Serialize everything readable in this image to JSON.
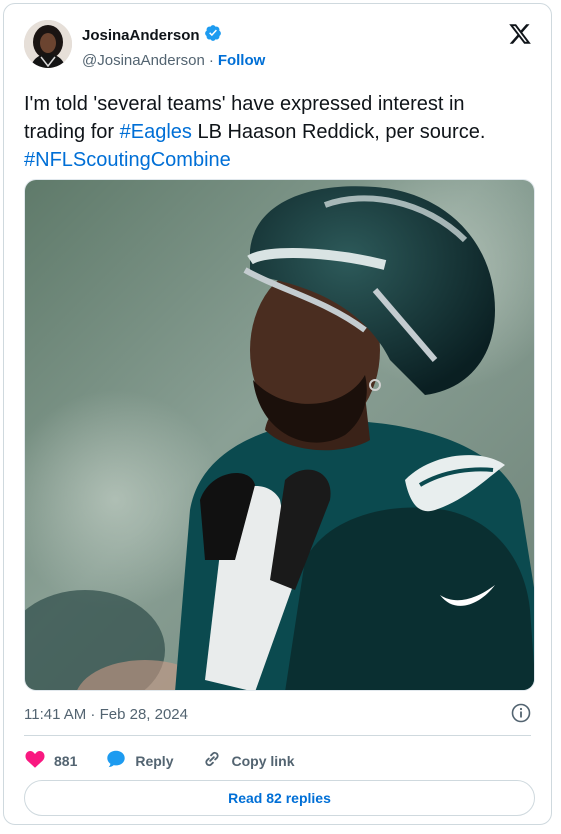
{
  "author": {
    "display_name": "JosinaAnderson",
    "handle": "@JosinaAnderson",
    "separator": "·",
    "follow_label": "Follow"
  },
  "tweet": {
    "text_part1": "I'm told 'several teams' have expressed interest in trading for ",
    "hashtag1": "#Eagles",
    "text_part2": " LB Haason Reddick, per source.",
    "hashtag2": "#NFLScoutingCombine",
    "timestamp": "11:41 AM · Feb 28, 2024"
  },
  "engagement": {
    "likes": "881",
    "reply_label": "Reply",
    "copy_link_label": "Copy link",
    "read_replies_label": "Read 82 replies"
  },
  "colors": {
    "accent": "#006fd6",
    "like": "#f91880",
    "verified": "#1d9bf0",
    "jersey": "#0b4a4f"
  },
  "icons": [
    "verified-badge-icon",
    "x-logo-icon",
    "info-icon",
    "heart-icon",
    "reply-bubble-icon",
    "link-icon"
  ]
}
